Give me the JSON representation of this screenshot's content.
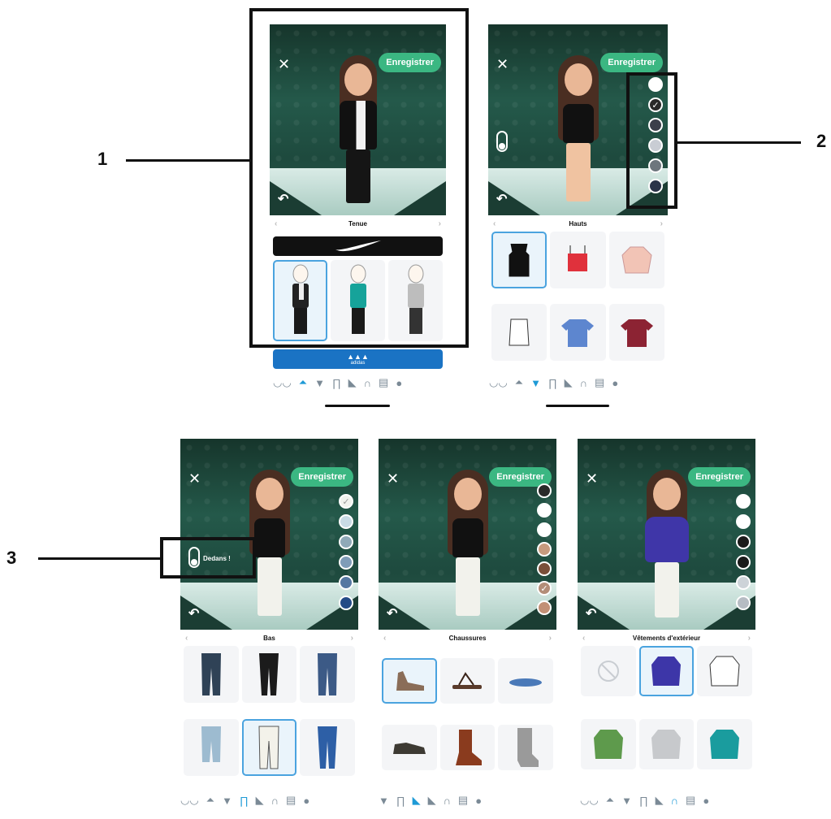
{
  "save_label": "Enregistrer",
  "close_glyph": "✕",
  "undo_glyph": "↶",
  "prev_glyph": "‹",
  "next_glyph": "›",
  "check_glyph": "✓",
  "screens": {
    "tenue": {
      "category": "Tenue"
    },
    "hauts": {
      "category": "Hauts"
    },
    "bas": {
      "category": "Bas",
      "toggle_label": "Dedans !"
    },
    "chaussures": {
      "category": "Chaussures"
    },
    "exterieur": {
      "category": "Vêtements d'extérieur"
    }
  },
  "brands": {
    "adidas": "adidas"
  },
  "callouts": {
    "one": "1",
    "two": "2",
    "three": "3"
  },
  "colors": {
    "save_green": "#3bb782",
    "accent_blue": "#1e9ad6",
    "hauts_swatches": [
      "#ffffff",
      "#2a2a2a",
      "#3b3f4a",
      "#c9cdd4",
      "#6d767d",
      "#2a3348"
    ],
    "bas_swatches": [
      "#f1f2ee",
      "#c9dbe6",
      "#8fa9b8",
      "#7f9cb8",
      "#5678a2",
      "#244a86"
    ],
    "chaussures_swatches": [
      "#2a2a2a",
      "#ffffff",
      "#ffffff",
      "#c79a7e",
      "#7a4f3a",
      "#b38d78",
      "#c29076"
    ],
    "exterieur_swatches": [
      "#ffffff",
      "#ffffff",
      "#1b1b1b",
      "#1b1b1b",
      "#cdd3d8",
      "#b6bcc3",
      "#6c7278"
    ]
  },
  "nav_icons": [
    "bra-icon",
    "hanger-icon",
    "tshirt-icon",
    "pants-icon",
    "shoe-icon",
    "jacket-icon",
    "locker-icon",
    "checkmark-icon"
  ]
}
